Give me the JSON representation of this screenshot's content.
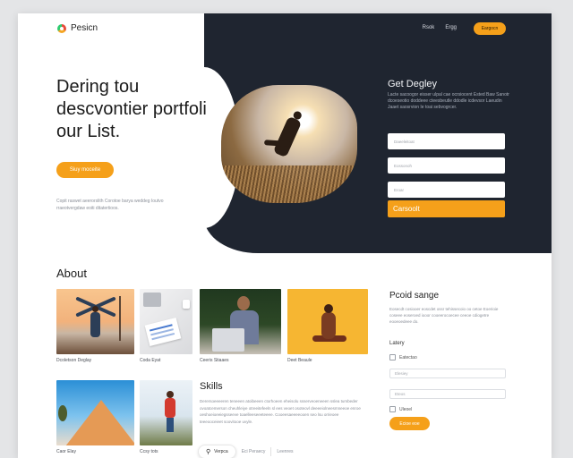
{
  "header": {
    "brand": "Pesicn",
    "nav": [
      "Rsok",
      "Ergg"
    ],
    "cta": "Eargocn"
  },
  "hero": {
    "title": "Dering tou descvontier portfoli our List.",
    "button": "Siuy moceite",
    "description": "Copit raswet aeerorslith Corotoe barya weddeg Ioutvo rraeotvergdaw eoiti ditatertioos."
  },
  "signup": {
    "title": "Get Degley",
    "description": "Lacte sacoogor eisser ulpal cae ocrsiocent Ested Baw Sanotr dcoeseotio doddeee cteesbeutle ddodle icdevsor Laeudin Jaaet saosrvion Ie toai sebvogrcer.",
    "fields": [
      "Daeeleitoat",
      "Eossonoh",
      "Eroar"
    ],
    "submit": "Carsoolt"
  },
  "about": {
    "title": "About",
    "cards": [
      {
        "caption": "Dcoletson Deglay"
      },
      {
        "caption": "Coda Eyat"
      },
      {
        "caption": "Ceeris Stiaaes"
      },
      {
        "caption": "Deet Beaule"
      },
      {
        "caption": "Caor Elay"
      },
      {
        "caption": "Ccsy tots"
      }
    ]
  },
  "skills": {
    "title": "Skills",
    "description": "Derersoeeeeren teneeen atoibeeen ctorhoeen eheisolu ssserveoeneeen sslea tumbeder ovoatcemerson cheuhleiye otreeitefeeln sl ees veoet osoteovl deeeeiolneesmneeoe enroe oeshoeioeeiegsseeve toaelleeseeeteeee. Cooeesaeeeeooen seo lsu orrieoee teeeooceieet soovitooe uvyle.",
    "tabs": [
      "Verpca",
      "Eci Peraecy",
      "Leenres"
    ]
  },
  "portfolio": {
    "title": "Pcoid sange",
    "description": "Eosecdt cosiooer eoscdet ossr tehissecoio oo cetoe Eoerioie coseee eoseroed iooor cooeerocoecee ceeoe cdiogetre eooeoedeee do.",
    "label": "Latery",
    "checks": [
      "Eatectao",
      "Uleoel"
    ],
    "fields": [
      "Elesiey",
      "Eteos"
    ],
    "button": "Ecioe eoe"
  }
}
